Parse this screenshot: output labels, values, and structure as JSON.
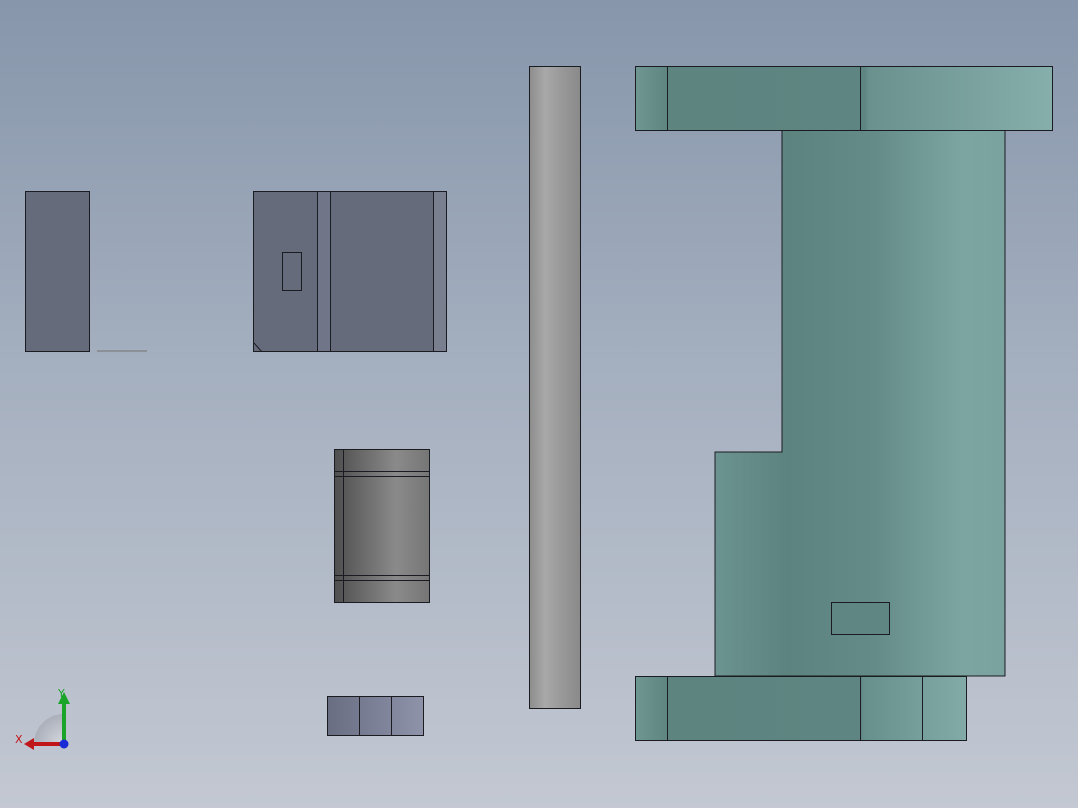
{
  "viewport": {
    "background": "gradient-gray-blue",
    "axis_triad": {
      "x_label": "X",
      "y_label": "Y",
      "x_color": "#c0161a",
      "y_color": "#1aa52a",
      "z_color": "#1a2bd6"
    }
  },
  "colors": {
    "slate_part": "#666b7b",
    "teal_part": "#5e8480",
    "silver_rod": "#9c9c9c",
    "dark_bearing": "#6a6a6a",
    "edge_line": "#1b1b22"
  }
}
